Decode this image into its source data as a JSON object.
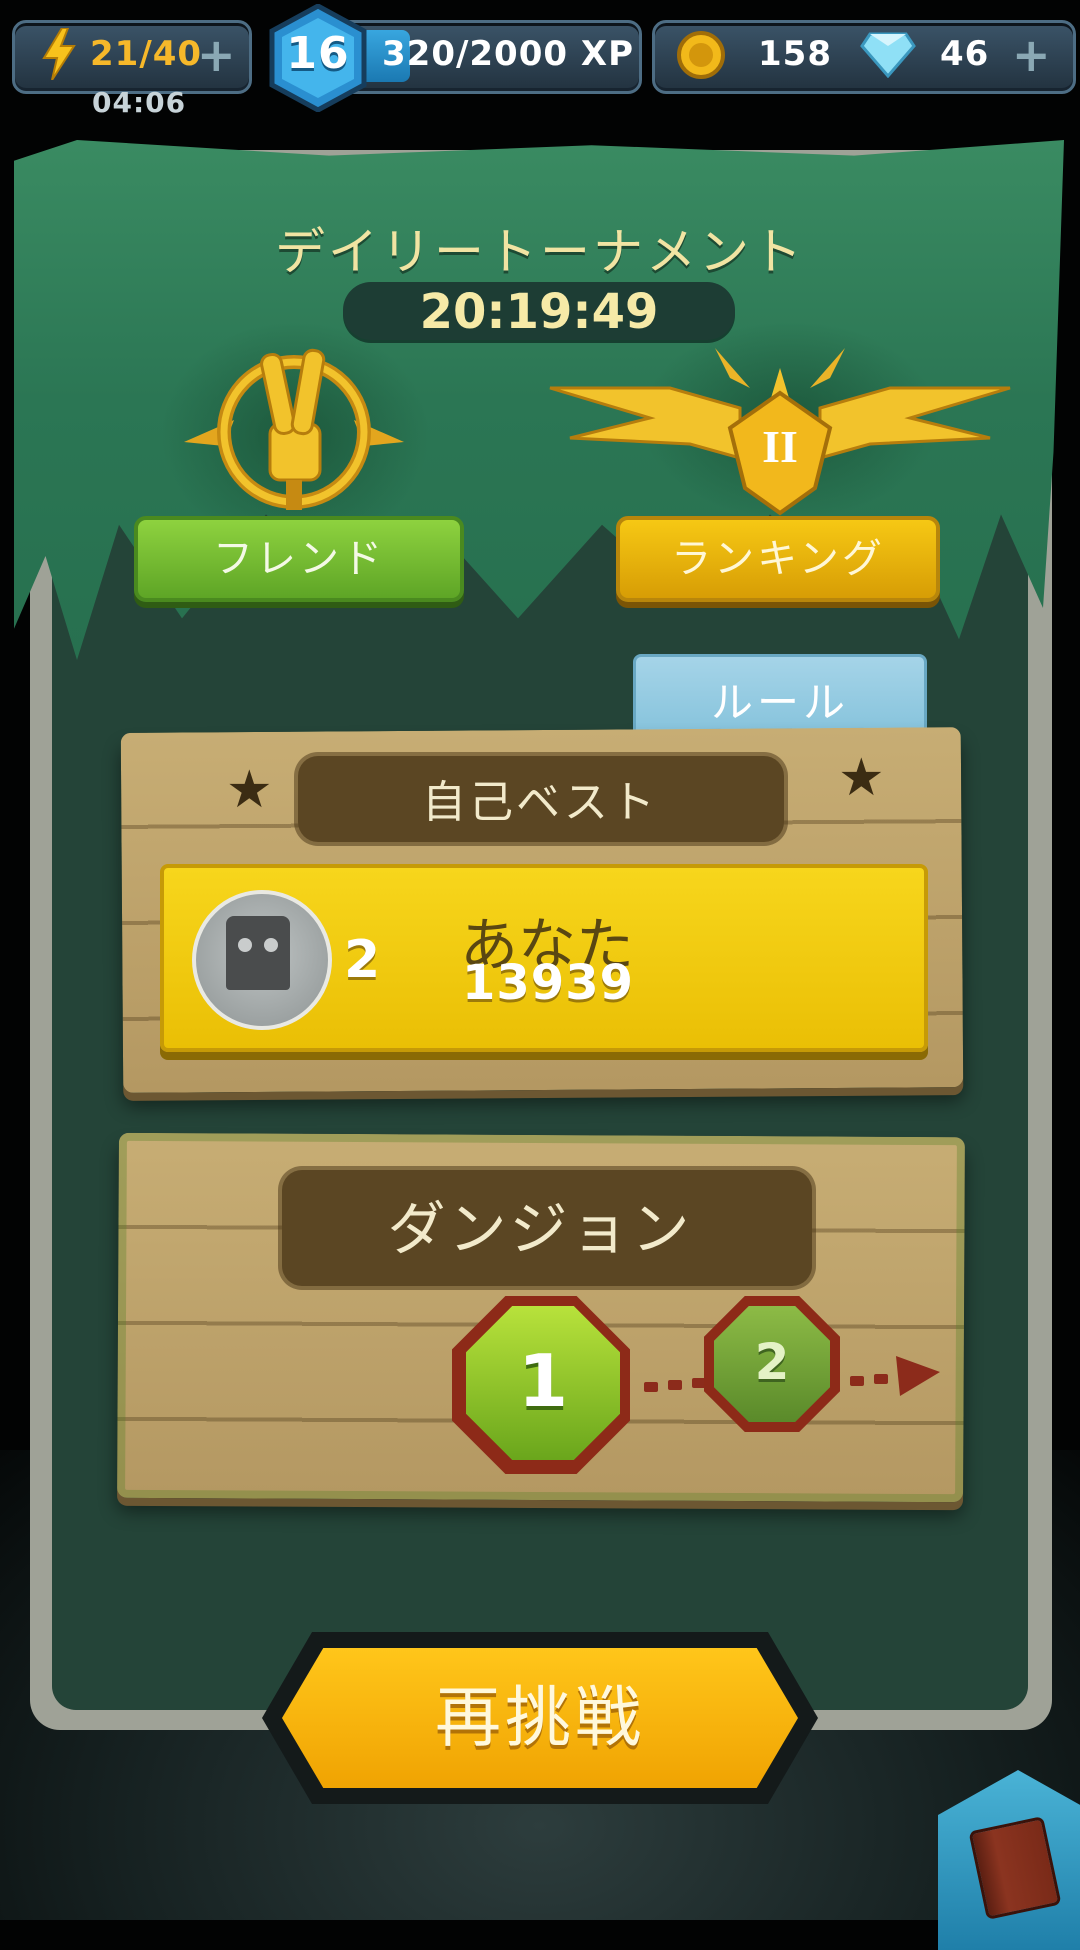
{
  "hud": {
    "energy": {
      "value": "21/40",
      "timer": "04:06"
    },
    "level": {
      "number": "16",
      "xp": "320/2000 XP",
      "progress": 0.16
    },
    "coins": "158",
    "gems": "46"
  },
  "tournament": {
    "title": "デイリートーナメント",
    "countdown": "20:19:49",
    "friends_label": "フレンド",
    "ranking_label": "ランキング",
    "rank_badge": "II",
    "rules_tab": "ルール"
  },
  "personal_best": {
    "title": "自己ベスト",
    "rank": "2",
    "name": "あなた",
    "score": "13939"
  },
  "dungeon": {
    "title": "ダンジョン",
    "nodes": [
      "1",
      "2"
    ]
  },
  "retry_label": "再挑戦",
  "colors": {
    "primary_button": "#f5b30a",
    "friends_button": "#74bd32",
    "ranking_button": "#eab40c",
    "rules_tab": "#93cbe1",
    "board": "#244438"
  },
  "icons": [
    "lightning-icon",
    "plus-icon",
    "coin-icon",
    "gem-icon",
    "victory-hand-emblem",
    "laurel-rank-emblem",
    "book-icon"
  ]
}
